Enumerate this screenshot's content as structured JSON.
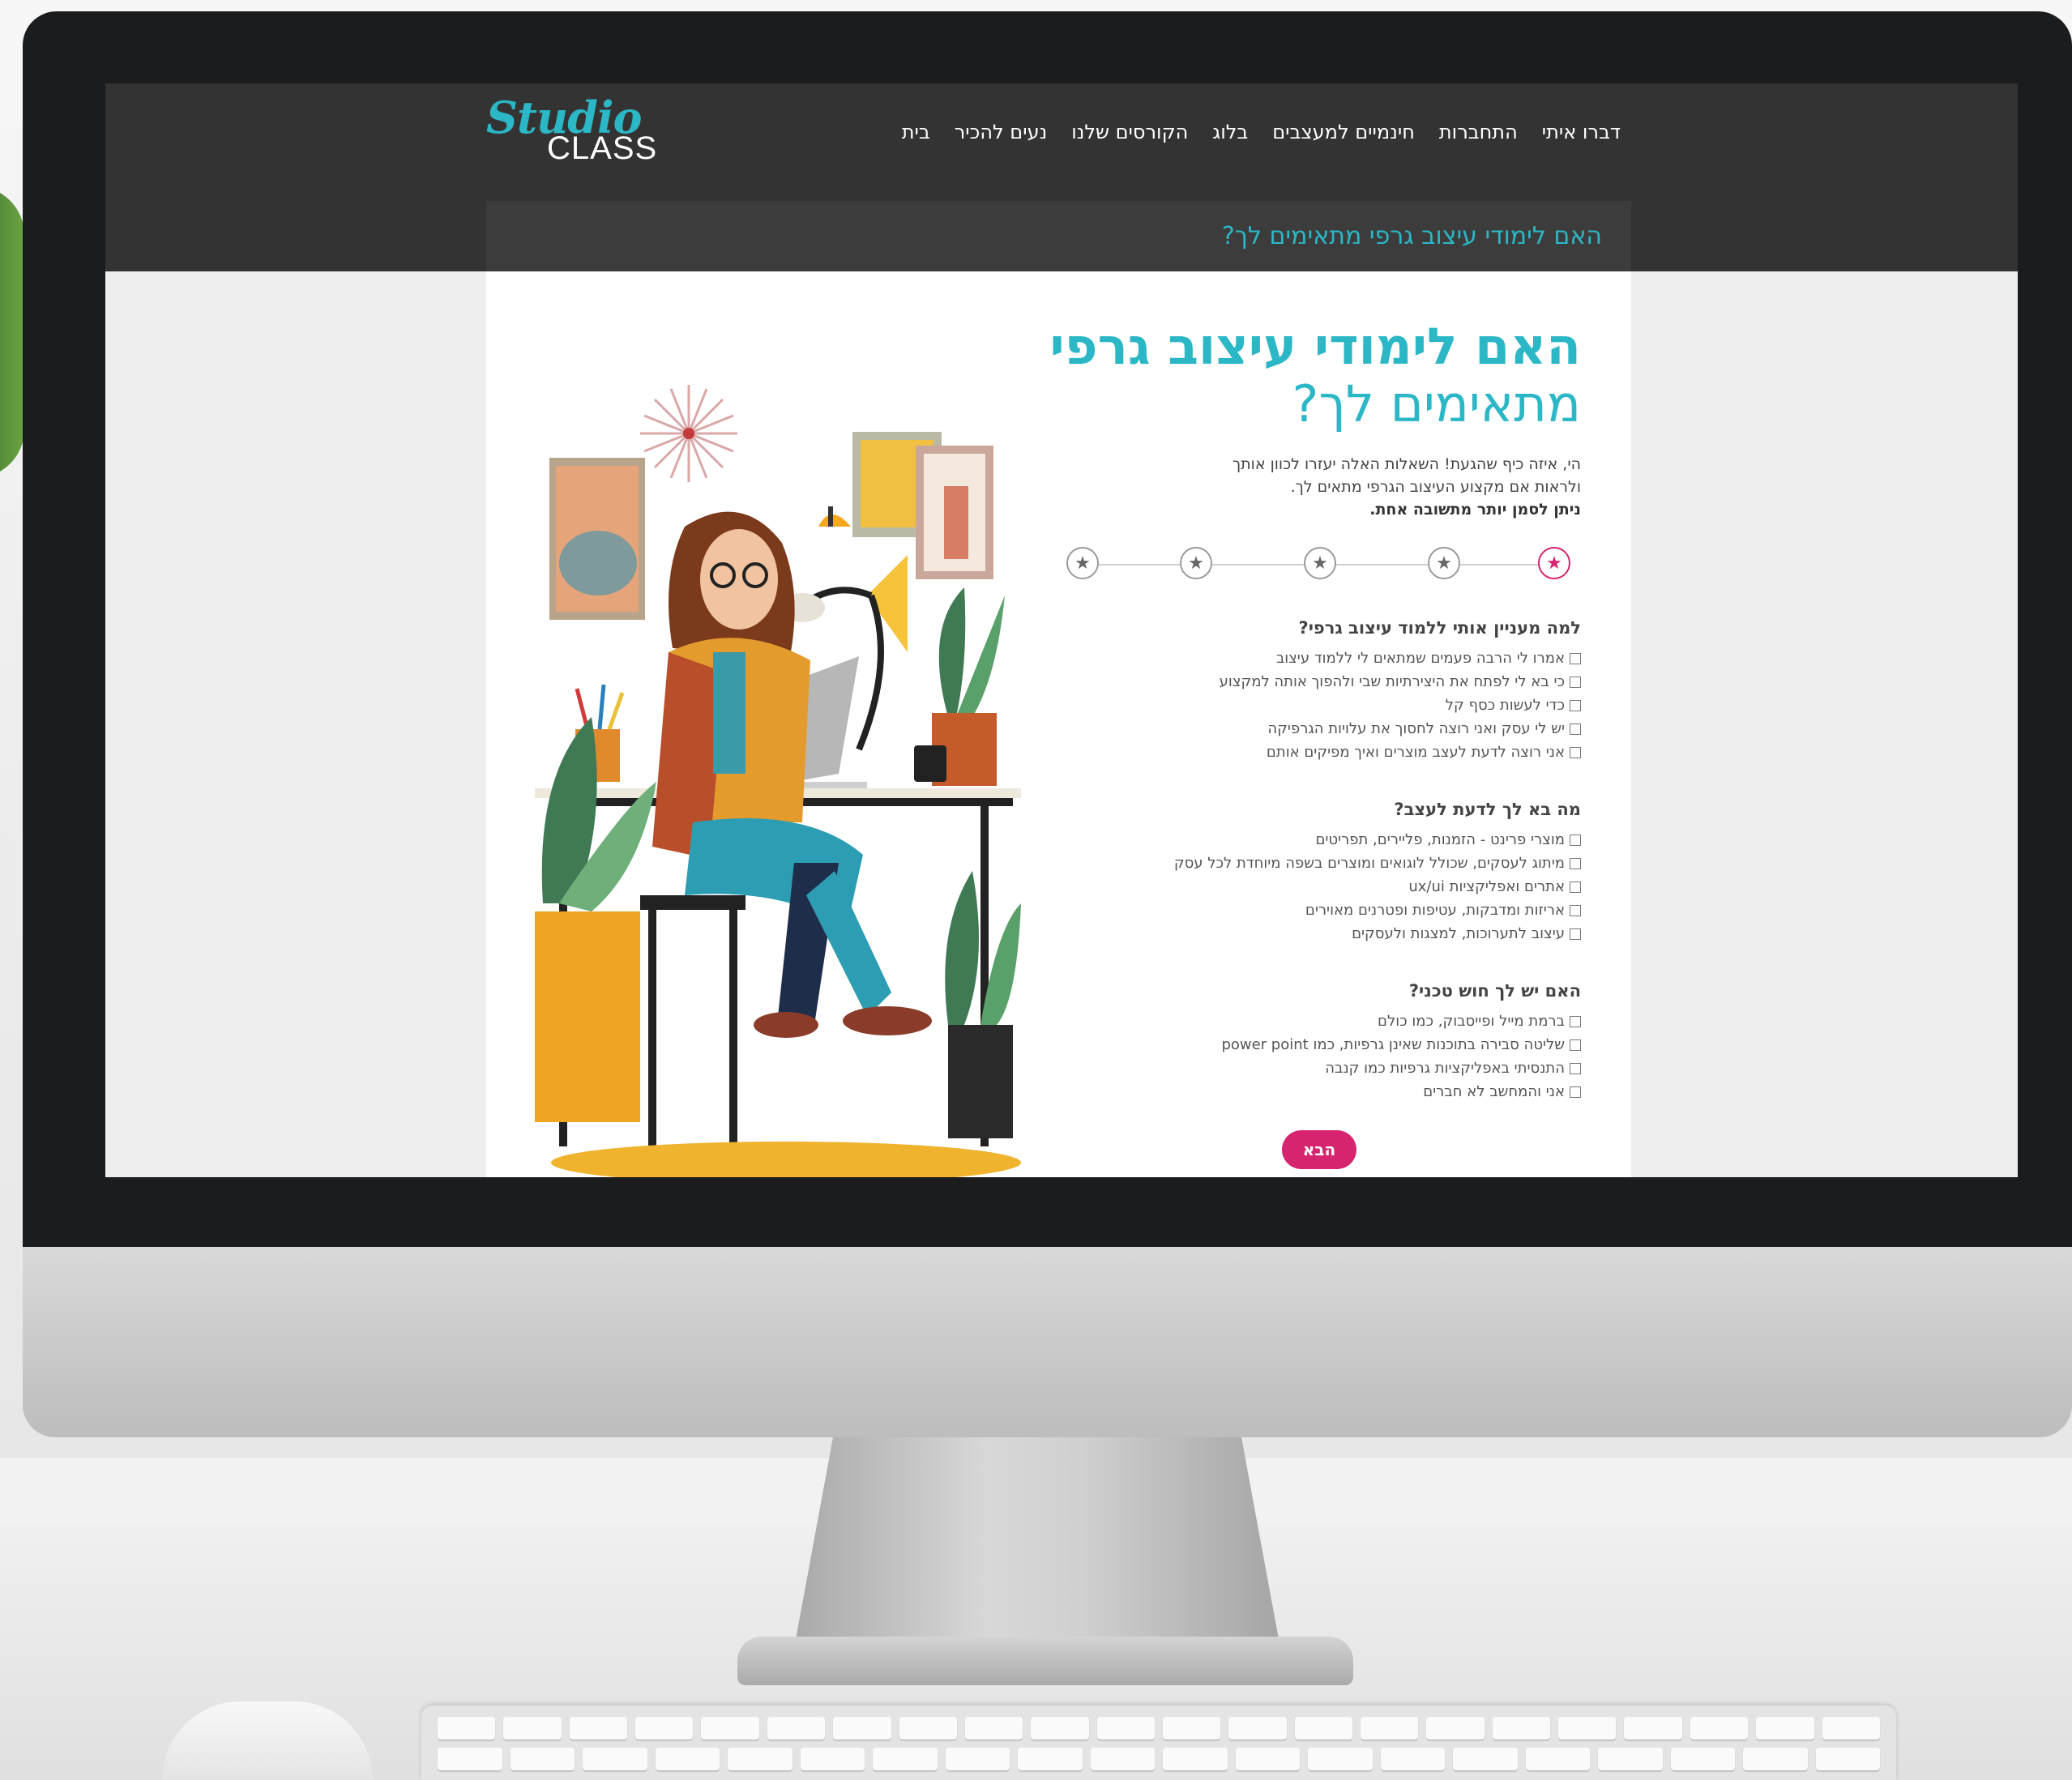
{
  "site": {
    "logo": {
      "studio": "Studio",
      "class": "CLASS"
    },
    "nav": [
      "בית",
      "נעים להכיר",
      "הקורסים שלנו",
      "בלוג",
      "חינמיים למעצבים",
      "התחברות",
      "דברו איתי"
    ]
  },
  "page": {
    "title_bar": "האם לימודי עיצוב גרפי מתאימים לך?",
    "heading_bold": "האם לימודי עיצוב גרפי",
    "heading_light": "מתאימים לך?",
    "intro_line1": "הי, איזה כיף שהגעת! השאלות האלה יעזרו לכוון אותך",
    "intro_line2": "ולראות אם מקצוע העיצוב הגרפי מתאים לך.",
    "intro_note": "ניתן לסמן יותר מתשובה אחת.",
    "steps_total": 5,
    "step_active": 1,
    "questions": [
      {
        "title": "למה מעניין אותי ללמוד עיצוב גרפי?",
        "options": [
          "אמרו לי הרבה פעמים שמתאים לי ללמוד עיצוב",
          "כי בא לי לפתח את היצירתיות שבי ולהפוך אותה למקצוע",
          "כדי לעשות כסף קל",
          "יש לי עסק ואני רוצה לחסוך את עלויות הגרפיקה",
          "אני רוצה לדעת לעצב מוצרים ואיך מפיקים אותם"
        ]
      },
      {
        "title": "מה בא לך לדעת לעצב?",
        "options": [
          "מוצרי פרינט - הזמנות, פליירים, תפריטים",
          "מיתוג לעסקים, שכולל לוגואים ומוצרים בשפה מיוחדת לכל עסק",
          "אתרים ואפליקציות ux/ui",
          "אריזות ומדבקות, עטיפות ופטרנים מאוירים",
          "עיצוב לתערוכות, למצגות ולעסקים"
        ]
      },
      {
        "title": "האם יש לך חוש טכני?",
        "options": [
          "ברמת מייל ופייסבוק, כמו כולם",
          "שליטה סבירה בתוכנות שאינן גרפיות, כמו power point",
          "התנסיתי באפליקציות גרפיות כמו קנבה",
          "אני והמחשב לא חברים"
        ]
      }
    ],
    "next_button": "הבא"
  },
  "colors": {
    "accent": "#2bb7c6",
    "primary_button": "#d6246e",
    "header_bg": "#333333"
  },
  "icons": [
    "star-icon",
    "checkbox-icon"
  ]
}
